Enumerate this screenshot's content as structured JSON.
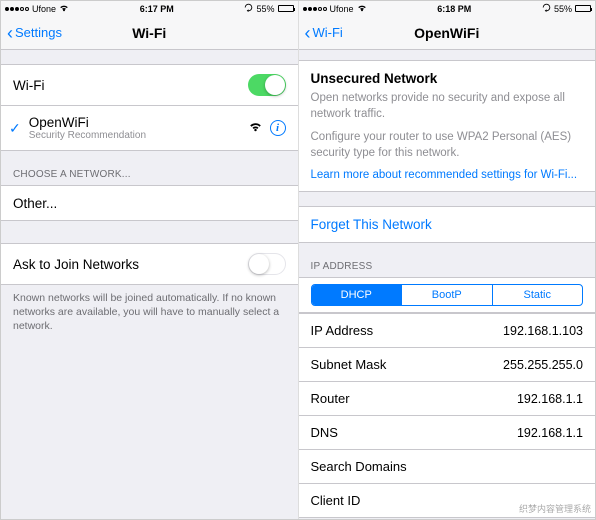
{
  "left": {
    "status": {
      "carrier": "Ufone",
      "time": "6:17 PM",
      "battery_pct": "55%",
      "battery_fill": 55
    },
    "nav": {
      "back": "Settings",
      "title": "Wi-Fi"
    },
    "wifi_toggle_label": "Wi-Fi",
    "wifi_toggle_on": true,
    "connected": {
      "name": "OpenWiFi",
      "subtitle": "Security Recommendation"
    },
    "choose_header": "CHOOSE A NETWORK...",
    "other_label": "Other...",
    "ask_label": "Ask to Join Networks",
    "ask_on": false,
    "footer": "Known networks will be joined automatically. If no known networks are available, you will have to manually select a network."
  },
  "right": {
    "status": {
      "carrier": "Ufone",
      "time": "6:18 PM",
      "battery_pct": "55%",
      "battery_fill": 55
    },
    "nav": {
      "back": "Wi-Fi",
      "title": "OpenWiFi"
    },
    "unsecured": {
      "heading": "Unsecured Network",
      "body1": "Open networks provide no security and expose all network traffic.",
      "body2": "Configure your router to use WPA2 Personal (AES) security type for this network.",
      "link": "Learn more about recommended settings for Wi-Fi..."
    },
    "forget": "Forget This Network",
    "ip_header": "IP ADDRESS",
    "segments": [
      "DHCP",
      "BootP",
      "Static"
    ],
    "segment_selected": 0,
    "rows": [
      {
        "k": "IP Address",
        "v": "192.168.1.103"
      },
      {
        "k": "Subnet Mask",
        "v": "255.255.255.0"
      },
      {
        "k": "Router",
        "v": "192.168.1.1"
      },
      {
        "k": "DNS",
        "v": "192.168.1.1"
      },
      {
        "k": "Search Domains",
        "v": ""
      },
      {
        "k": "Client ID",
        "v": ""
      }
    ]
  },
  "watermark": "织梦内容管理系统"
}
